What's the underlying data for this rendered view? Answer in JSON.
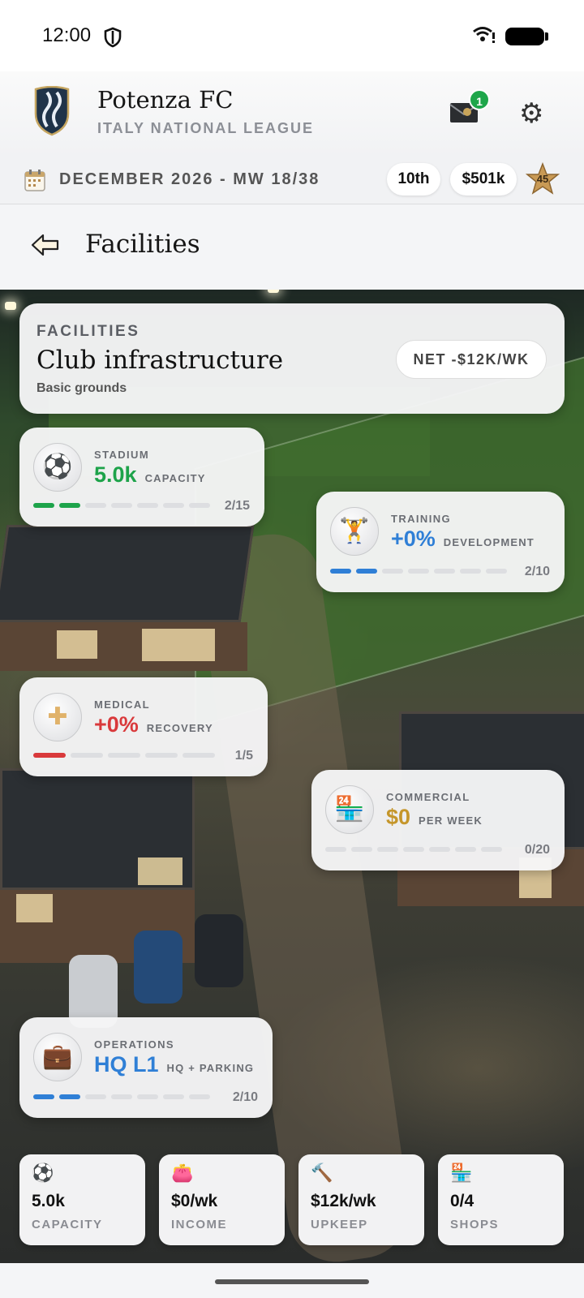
{
  "status_bar": {
    "time": "12:00"
  },
  "header": {
    "club_name": "Potenza FC",
    "league": "ITALY NATIONAL LEAGUE",
    "mail_badge": "1"
  },
  "info_bar": {
    "date": "DECEMBER 2026 - MW 18/38",
    "rank": "10th",
    "money": "$501k",
    "star_value": "45"
  },
  "page": {
    "title": "Facilities"
  },
  "summary": {
    "kicker": "FACILITIES",
    "title": "Club infrastructure",
    "subtitle": "Basic grounds",
    "net": "NET -$12K/WK"
  },
  "facilities": [
    {
      "key": "stadium",
      "label": "STADIUM",
      "value": "5.0k",
      "unit": "CAPACITY",
      "count": "2/15",
      "level": 2,
      "max_segments": 7,
      "color": "#1da34a",
      "icon": "soccer-ball-icon",
      "glyph": "⚽"
    },
    {
      "key": "training",
      "label": "TRAINING",
      "value": "+0%",
      "unit": "DEVELOPMENT",
      "count": "2/10",
      "level": 2,
      "max_segments": 7,
      "color": "#2f7fd6",
      "icon": "dumbbell-icon",
      "glyph": "🏋"
    },
    {
      "key": "medical",
      "label": "MEDICAL",
      "value": "+0%",
      "unit": "RECOVERY",
      "count": "1/5",
      "level": 1,
      "max_segments": 5,
      "color": "#d9393b",
      "icon": "medical-cross-icon",
      "glyph": "✚"
    },
    {
      "key": "commercial",
      "label": "COMMERCIAL",
      "value": "$0",
      "unit": "PER WEEK",
      "count": "0/20",
      "level": 0,
      "max_segments": 7,
      "color": "#c5962b",
      "icon": "shop-icon",
      "glyph": "🏪"
    },
    {
      "key": "operations",
      "label": "OPERATIONS",
      "value": "HQ L1",
      "unit": "HQ + PARKING",
      "count": "2/10",
      "level": 2,
      "max_segments": 7,
      "color": "#2f7fd6",
      "icon": "briefcase-icon",
      "glyph": "💼"
    }
  ],
  "stats": [
    {
      "icon": "soccer-ball-icon",
      "glyph": "⚽",
      "value": "5.0k",
      "label": "CAPACITY"
    },
    {
      "icon": "wallet-icon",
      "glyph": "👛",
      "value": "$0/wk",
      "label": "INCOME"
    },
    {
      "icon": "hammer-icon",
      "glyph": "🔨",
      "value": "$12k/wk",
      "label": "UPKEEP"
    },
    {
      "icon": "shop-icon",
      "glyph": "🏪",
      "value": "0/4",
      "label": "SHOPS"
    }
  ]
}
